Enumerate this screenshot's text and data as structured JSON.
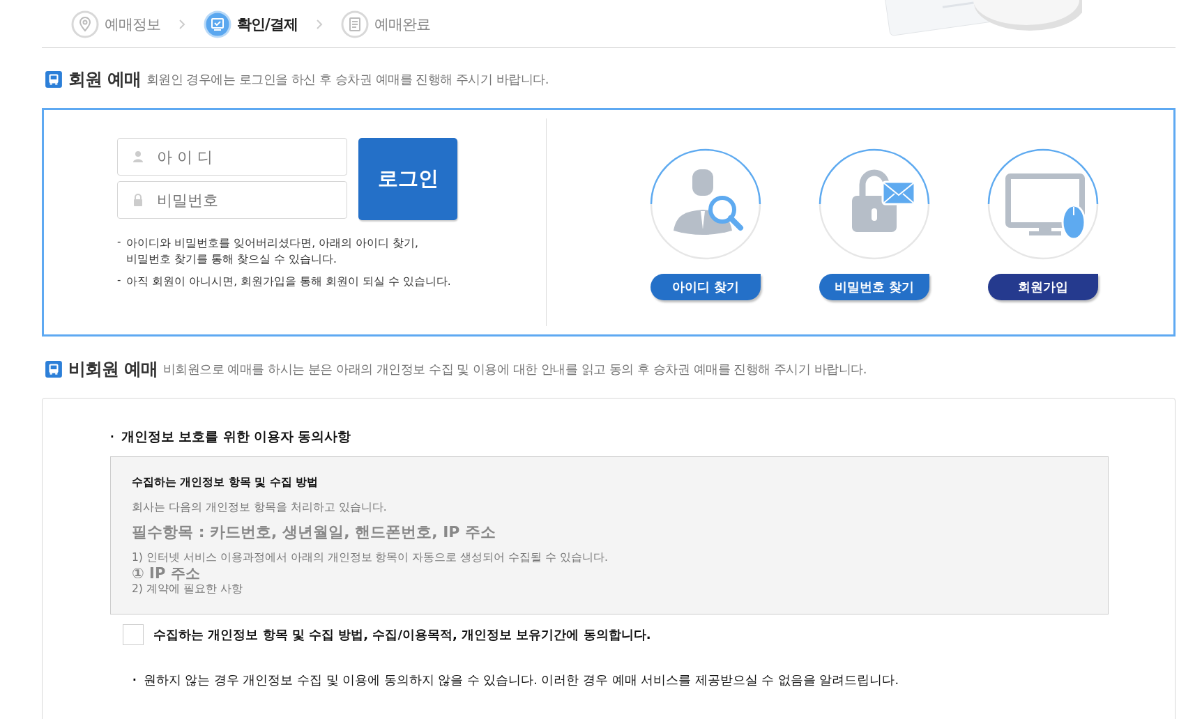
{
  "steps": [
    {
      "label": "예매정보",
      "selected": false,
      "kind": "pin"
    },
    {
      "label": "확인/결제",
      "selected": true,
      "kind": "check"
    },
    {
      "label": "예매완료",
      "selected": false,
      "kind": "doc"
    }
  ],
  "member": {
    "title": "회원 예매",
    "description": "회원인 경우에는 로그인을 하신 후 승차권 예매를 진행해 주시기 바랍니다.",
    "id_field": {
      "placeholder": "아 이 디"
    },
    "password_field": {
      "placeholder": "비밀번호"
    },
    "login_button": "로그인",
    "notes": [
      {
        "marker": "-",
        "text": "아이디와 비밀번호를 잊어버리셨다면, 아래의 아이디 찾기,\n비밀번호 찾기를 통해 찾으실 수 있습니다."
      },
      {
        "marker": "-",
        "text": "아직 회원이 아니시면, 회원가입을 통해 회원이 되실 수 있습니다."
      }
    ],
    "actions": [
      {
        "label": "아이디 찾기",
        "kind": "person",
        "color": "#2470c8"
      },
      {
        "label": "비밀번호 찾기",
        "kind": "lock",
        "color": "#2470c8"
      },
      {
        "label": "회원가입",
        "kind": "monitor",
        "color": "#253a8e"
      }
    ]
  },
  "nonmember": {
    "title": "비회원 예매",
    "description": "비회원으로 예매를 하시는 분은 아래의 개인정보 수집 및 이용에 대한 안내를 읽고 동의 후 승차권 예매를  진행해 주시기 바랍니다.",
    "consent_heading": {
      "marker": "·",
      "text": "개인정보 보호를 위한 이용자 동의사항"
    },
    "terms": [
      {
        "kind": "heading",
        "text": "수집하는 개인정보 항목 및 수집 방법"
      },
      {
        "kind": "text",
        "text": "회사는 다음의 개인정보 항목을 처리하고 있습니다."
      },
      {
        "kind": "emphasis",
        "text": "필수항목 : 카드번호, 생년월일, 핸드폰번호, IP 주소"
      },
      {
        "kind": "text",
        "text": "1) 인터넷 서비스 이용과정에서 아래의 개인정보 항목이 자동으로 생성되어 수집될 수 있습니다."
      },
      {
        "kind": "item",
        "text": "① IP 주소"
      },
      {
        "kind": "text",
        "text": "2) 계약에 필요한 사항"
      }
    ],
    "agree": {
      "label": "수집하는 개인정보 항목 및 수집 방법, 수집/이용목적, 개인정보 보유기간에 동의합니다.",
      "checked": false
    },
    "notice": {
      "marker": "·",
      "text": "원하지 않는 경우 개인정보 수집 및 이용에 동의하지 않을 수 있습니다. 이러한 경우 예매 서비스를 제공받으실 수 없음을 알려드립니다."
    }
  }
}
